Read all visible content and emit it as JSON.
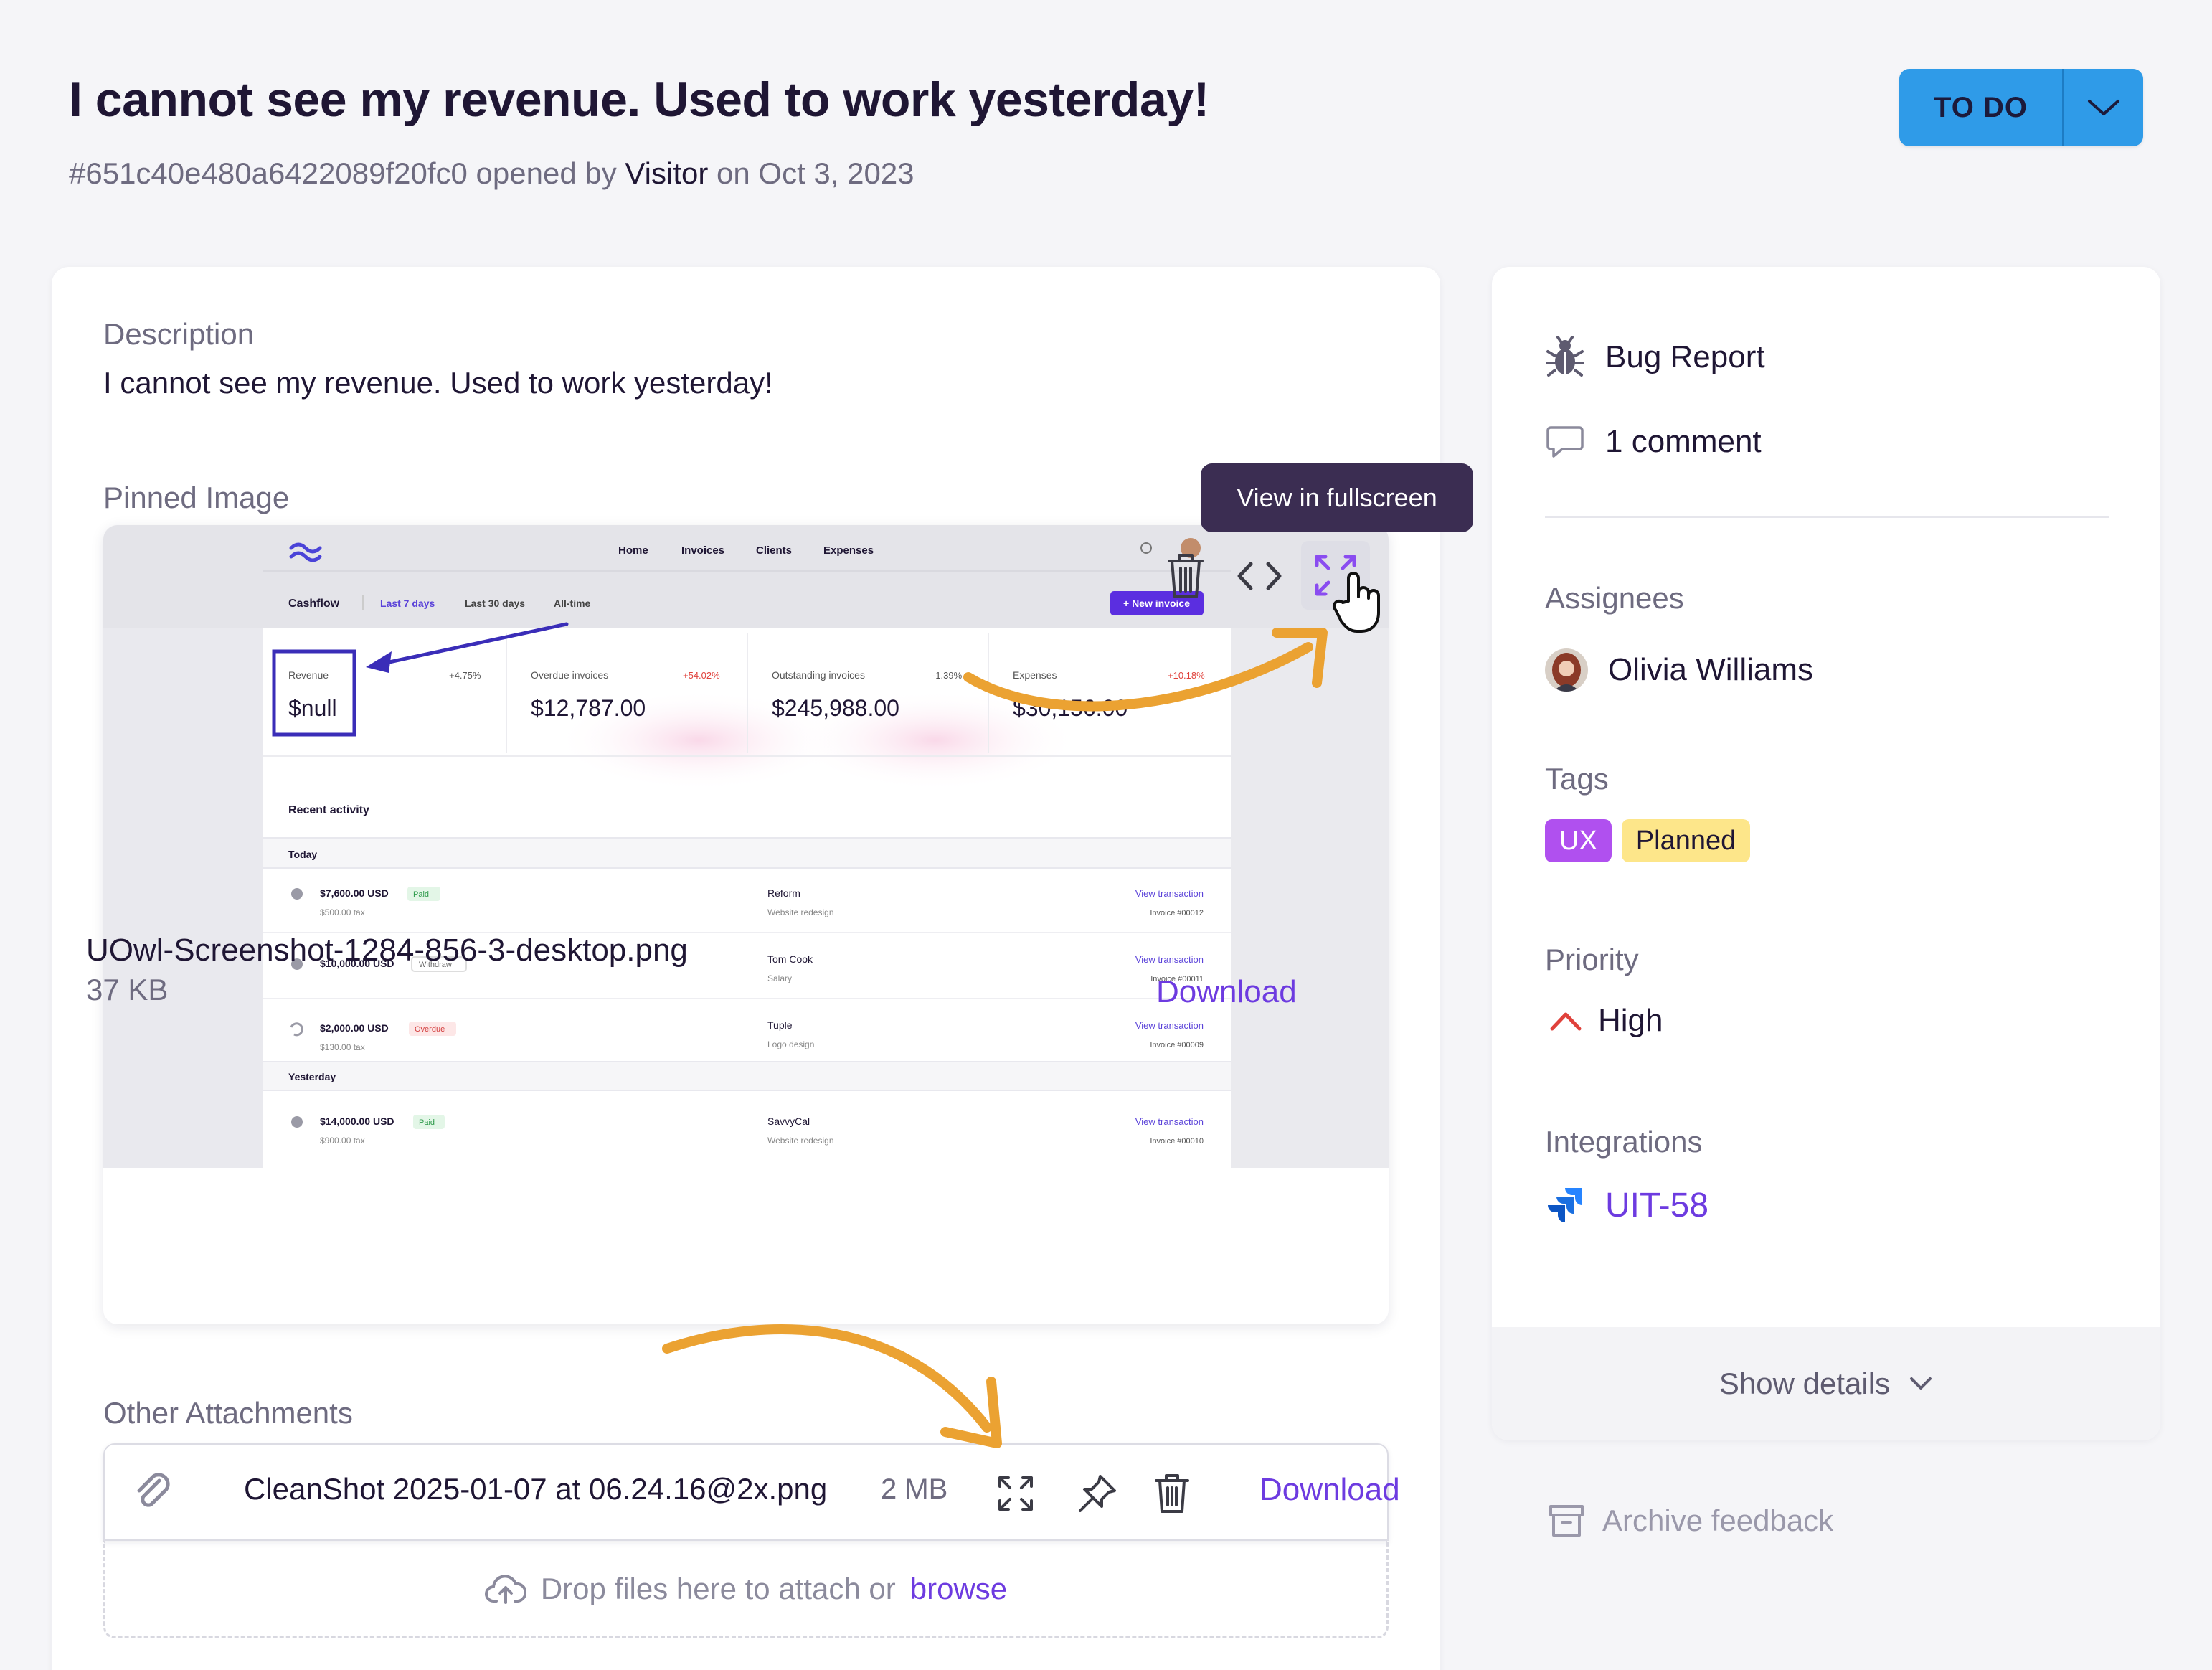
{
  "header": {
    "title": "I cannot see my revenue. Used to work yesterday!",
    "id": "#651c40e480a6422089f20fc0",
    "opened_by_prefix": "opened by",
    "author": "Visitor",
    "date_text": "on Oct 3, 2023",
    "status_label": "TO DO"
  },
  "main": {
    "description_label": "Description",
    "description_text": "I cannot see my revenue. Used to work yesterday!",
    "pinned_label": "Pinned Image",
    "tooltip": "View in fullscreen",
    "pinned_file": {
      "name": "UOwl-Screenshot-1284-856-3-desktop.png",
      "size": "37 KB",
      "download": "Download"
    },
    "other_label": "Other Attachments",
    "attachment": {
      "name": "CleanShot 2025-01-07 at 06.24.16@2x.png",
      "size": "2 MB",
      "download": "Download"
    },
    "drop_text": "Drop files here to attach or",
    "drop_link": "browse"
  },
  "preview": {
    "nav": [
      "Home",
      "Invoices",
      "Clients",
      "Expenses"
    ],
    "tabs": [
      "Cashflow",
      "Last 7 days",
      "Last 30 days",
      "All-time"
    ],
    "new_invoice": "+ New invoice",
    "stats": [
      {
        "label": "Revenue",
        "value": "$null",
        "change": "+4.75%"
      },
      {
        "label": "Overdue invoices",
        "value": "$12,787.00",
        "change": "+54.02%"
      },
      {
        "label": "Outstanding invoices",
        "value": "$245,988.00",
        "change": "-1.39%"
      },
      {
        "label": "Expenses",
        "value": "$30,156.00",
        "change": "+10.18%"
      }
    ],
    "recent_activity": "Recent activity",
    "today": "Today",
    "yesterday": "Yesterday",
    "rows": [
      {
        "amount": "$7,600.00 USD",
        "badge": "Paid",
        "tax": "$500.00 tax",
        "client": "Reform",
        "desc": "Website redesign",
        "link": "View transaction",
        "invoice": "Invoice #00012"
      },
      {
        "amount": "$10,000.00 USD",
        "badge": "Withdraw",
        "tax": "",
        "client": "Tom Cook",
        "desc": "Salary",
        "link": "View transaction",
        "invoice": "Invoice #00011"
      },
      {
        "amount": "$2,000.00 USD",
        "badge": "Overdue",
        "tax": "$130.00 tax",
        "client": "Tuple",
        "desc": "Logo design",
        "link": "View transaction",
        "invoice": "Invoice #00009"
      },
      {
        "amount": "$14,000.00 USD",
        "badge": "Paid",
        "tax": "$900.00 tax",
        "client": "SavvyCal",
        "desc": "Website redesign",
        "link": "View transaction",
        "invoice": "Invoice #00010"
      }
    ]
  },
  "side": {
    "type": "Bug Report",
    "comments": "1 comment",
    "assignees_label": "Assignees",
    "assignee": "Olivia Williams",
    "tags_label": "Tags",
    "tags": [
      "UX",
      "Planned"
    ],
    "priority_label": "Priority",
    "priority": "High",
    "integrations_label": "Integrations",
    "integration": "UIT-58",
    "show_details": "Show details",
    "archive": "Archive feedback"
  },
  "colors": {
    "accent": "#6d3be0",
    "status": "#2f9be8",
    "priority_high": "#e0413b",
    "tag_ux": "#b050ef",
    "tag_planned": "#fde68a",
    "annotation_arrow": "#eba232"
  },
  "icons": [
    "chevron-down-icon",
    "trash-icon",
    "code-icon",
    "fullscreen-icon",
    "hand-cursor-icon",
    "bug-icon",
    "comment-icon",
    "priority-up-icon",
    "jira-icon",
    "paperclip-icon",
    "pin-icon",
    "cloud-upload-icon",
    "archive-icon"
  ]
}
